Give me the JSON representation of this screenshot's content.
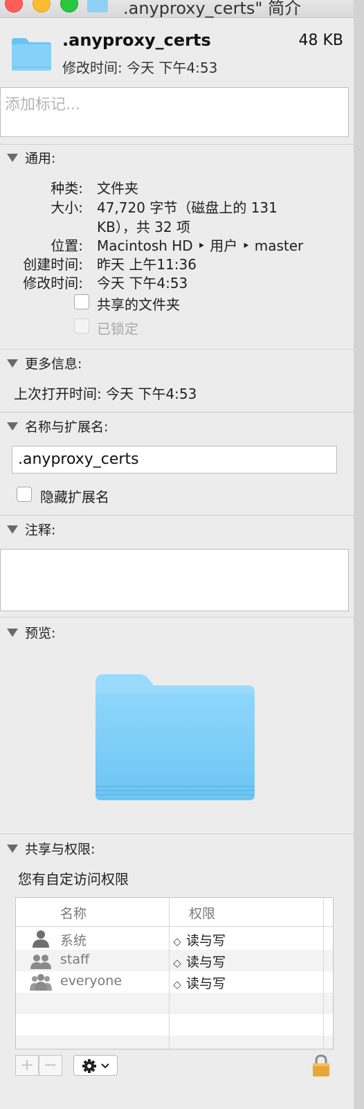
{
  "window": {
    "title": ".anyproxy_certs\" 简介"
  },
  "header": {
    "name": ".anyproxy_certs",
    "size": "48 KB",
    "modified": "修改时间: 今天 下午4:53"
  },
  "tags": {
    "placeholder": "添加标记..."
  },
  "general": {
    "title": "通用:",
    "kind_label": "种类:",
    "kind_value": "文件夹",
    "size_label": "大小:",
    "size_value_line1": "47,720 字节（磁盘上的 131",
    "size_value_line2": "KB），共 32 项",
    "where_label": "位置:",
    "where_value": "Macintosh HD ‣ 用户 ‣ master",
    "created_label": "创建时间:",
    "created_value": "昨天 上午11:36",
    "modified_label": "修改时间:",
    "modified_value": "今天 下午4:53",
    "shared_folder_label": "共享的文件夹",
    "locked_label": "已锁定"
  },
  "more_info": {
    "title": "更多信息:",
    "last_opened": "上次打开时间: 今天 下午4:53"
  },
  "name_ext": {
    "title": "名称与扩展名:",
    "name_value": ".anyproxy_certs",
    "hide_ext_label": "隐藏扩展名"
  },
  "comments": {
    "title": "注释:"
  },
  "preview": {
    "title": "预览:"
  },
  "permissions": {
    "title": "共享与权限:",
    "note": "您有自定访问权限",
    "col_name": "名称",
    "col_privilege": "权限",
    "rows": [
      {
        "name": "系统",
        "privilege": "读与写",
        "icon": "single-user-icon"
      },
      {
        "name": "staff",
        "privilege": "读与写",
        "icon": "group-icon"
      },
      {
        "name": "everyone",
        "privilege": "读与写",
        "icon": "everyone-icon"
      }
    ],
    "add_label": "+",
    "remove_label": "−"
  },
  "colors": {
    "folder_blue": "#7fcdf7",
    "close": "#ff5f57",
    "minimize": "#febc2e",
    "zoom": "#28c840"
  }
}
